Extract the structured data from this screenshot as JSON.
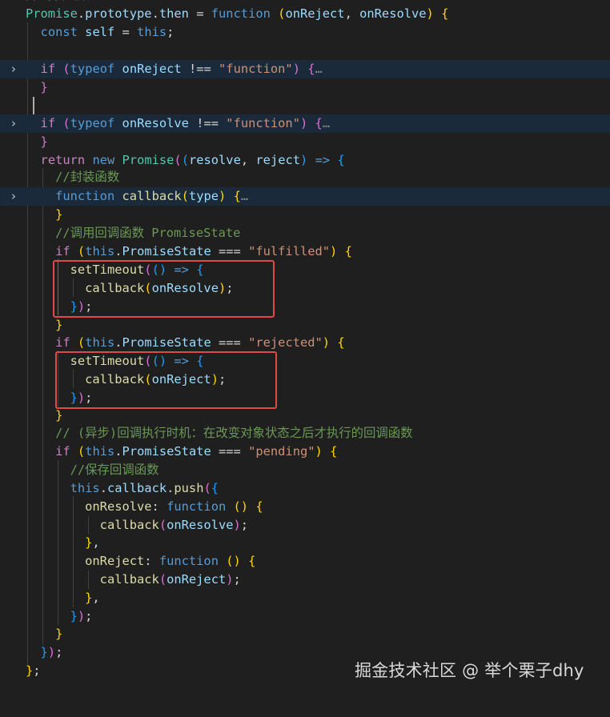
{
  "code": {
    "fold_marker": "›",
    "ellipsis": "…",
    "tokens": {
      "promise": "Promise",
      "prototype": "prototype",
      "then": "then",
      "function": "function",
      "on_reject": "onReject",
      "on_resolve": "onResolve",
      "const": "const",
      "self": "self",
      "this": "this",
      "if": "if",
      "typeof": "typeof",
      "str_function": "\"function\"",
      "return": "return",
      "new": "new",
      "resolve": "resolve",
      "reject": "reject",
      "callback": "callback",
      "type": "type",
      "promise_state": "PromiseState",
      "str_fulfilled": "\"fulfilled\"",
      "str_rejected": "\"rejected\"",
      "str_pending": "\"pending\"",
      "set_timeout": "setTimeout",
      "push": "push",
      "comment_wrap": "//封装函数",
      "comment_call": "//调用回调函数 PromiseState",
      "comment_async": "// (异步)回调执行时机：在改变对象状态之后才执行的回调函数",
      "comment_save": "//保存回调函数"
    }
  },
  "watermark": "掘金技术社区 @ 举个栗子dhy"
}
